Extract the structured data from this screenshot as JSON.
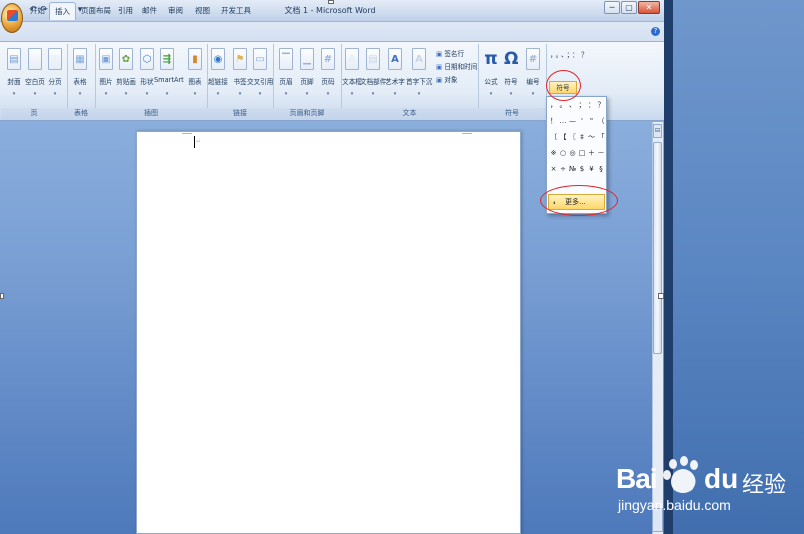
{
  "window": {
    "title": "文档 1 - Microsoft Word",
    "min": "─",
    "max": "▢",
    "close": "✕"
  },
  "quick_access": {
    "save": "▣",
    "undo": "↶",
    "redo": "↷",
    "customize": "▾"
  },
  "tabs": [
    "开始",
    "插入",
    "页面布局",
    "引用",
    "邮件",
    "审阅",
    "视图",
    "开发工具"
  ],
  "active_tab": "插入",
  "help": "?",
  "ribbon": {
    "groups": [
      {
        "label": "页",
        "buttons": [
          "封面",
          "空白页",
          "分页"
        ]
      },
      {
        "label": "表格",
        "buttons": [
          "表格"
        ]
      },
      {
        "label": "插图",
        "buttons": [
          "图片",
          "剪贴画",
          "形状",
          "SmartArt",
          "图表"
        ]
      },
      {
        "label": "链接",
        "buttons": [
          "超链接",
          "书签",
          "交叉引用"
        ]
      },
      {
        "label": "页眉和页脚",
        "buttons": [
          "页眉",
          "页脚",
          "页码"
        ]
      },
      {
        "label": "文本",
        "buttons": [
          "文本框",
          "文档部件",
          "艺术字",
          "首字下沉"
        ],
        "small": [
          "签名行",
          "日期和时间",
          "对象"
        ]
      },
      {
        "label": "符号",
        "buttons": [
          "公式",
          "符号",
          "编号"
        ]
      }
    ],
    "special_symbol_button": "符号",
    "special_symbol_chars": "，。、；：？"
  },
  "symbol_menu": {
    "rows": [
      [
        "，",
        "。",
        "、",
        "；",
        "：",
        "？"
      ],
      [
        "！",
        "…",
        "—",
        "'",
        "\"",
        "（"
      ],
      [
        "〔",
        "【",
        "〖",
        "‡",
        "～",
        "「"
      ],
      [
        "※",
        "○",
        "◎",
        "□",
        "＋",
        "－"
      ],
      [
        "×",
        "÷",
        "№",
        "$",
        "¥",
        "§"
      ]
    ],
    "more_label": "更多..."
  },
  "watermark": {
    "brand": "Bai",
    "brand_suffix": "du",
    "product": "经验",
    "url": "jingyan.baidu.com"
  },
  "colors": {
    "annotation": "#e0262b",
    "ribbon_bg": "#e3ecf7",
    "accent": "#ffd669"
  }
}
